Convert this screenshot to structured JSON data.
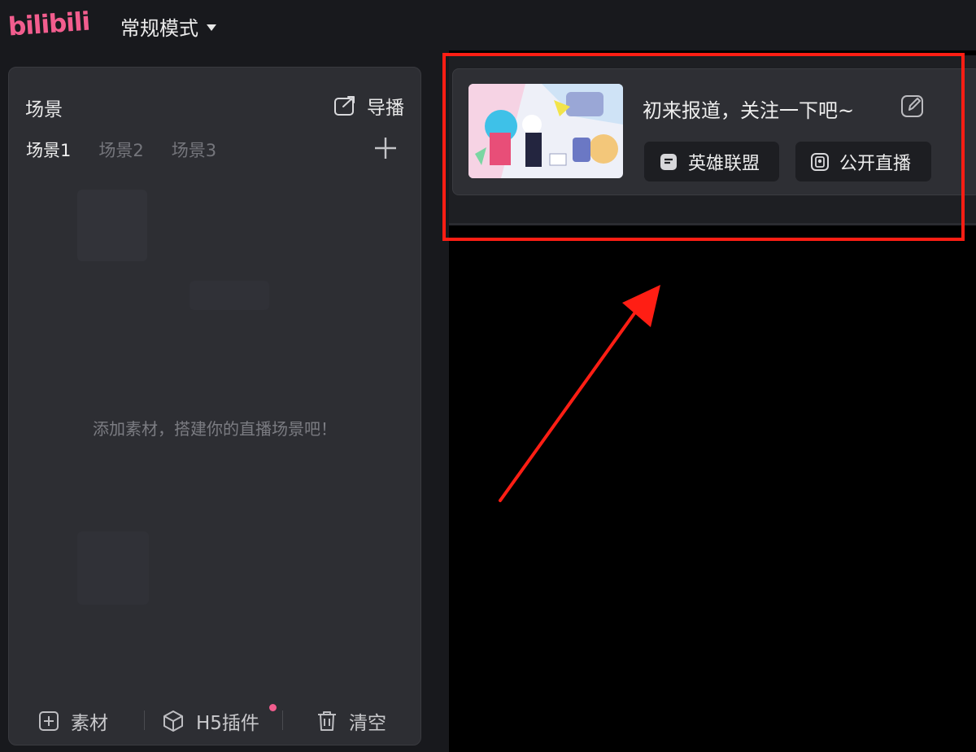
{
  "app": {
    "logo": "bilibili",
    "mode_label": "常规模式"
  },
  "scene_panel": {
    "title": "场景",
    "director_label": "导播",
    "tabs": [
      "场景1",
      "场景2",
      "场景3"
    ],
    "active_tab": 0,
    "empty_hint": "添加素材，搭建你的直播场景吧！",
    "bottom_actions": {
      "material": "素材",
      "h5_plugin": "H5插件",
      "clear": "清空"
    }
  },
  "stream_info": {
    "title": "初来报道，关注一下吧~",
    "category": "英雄联盟",
    "visibility": "公开直播"
  },
  "colors": {
    "brand": "#f25d8e",
    "annotation": "#ff1e14",
    "background": "#18191d",
    "panel": "#2d2e33"
  },
  "icons": [
    "caret-down-icon",
    "external-link-icon",
    "plus-icon",
    "add-square-icon",
    "cube-icon",
    "trash-icon",
    "edit-icon",
    "category-icon",
    "public-icon"
  ]
}
